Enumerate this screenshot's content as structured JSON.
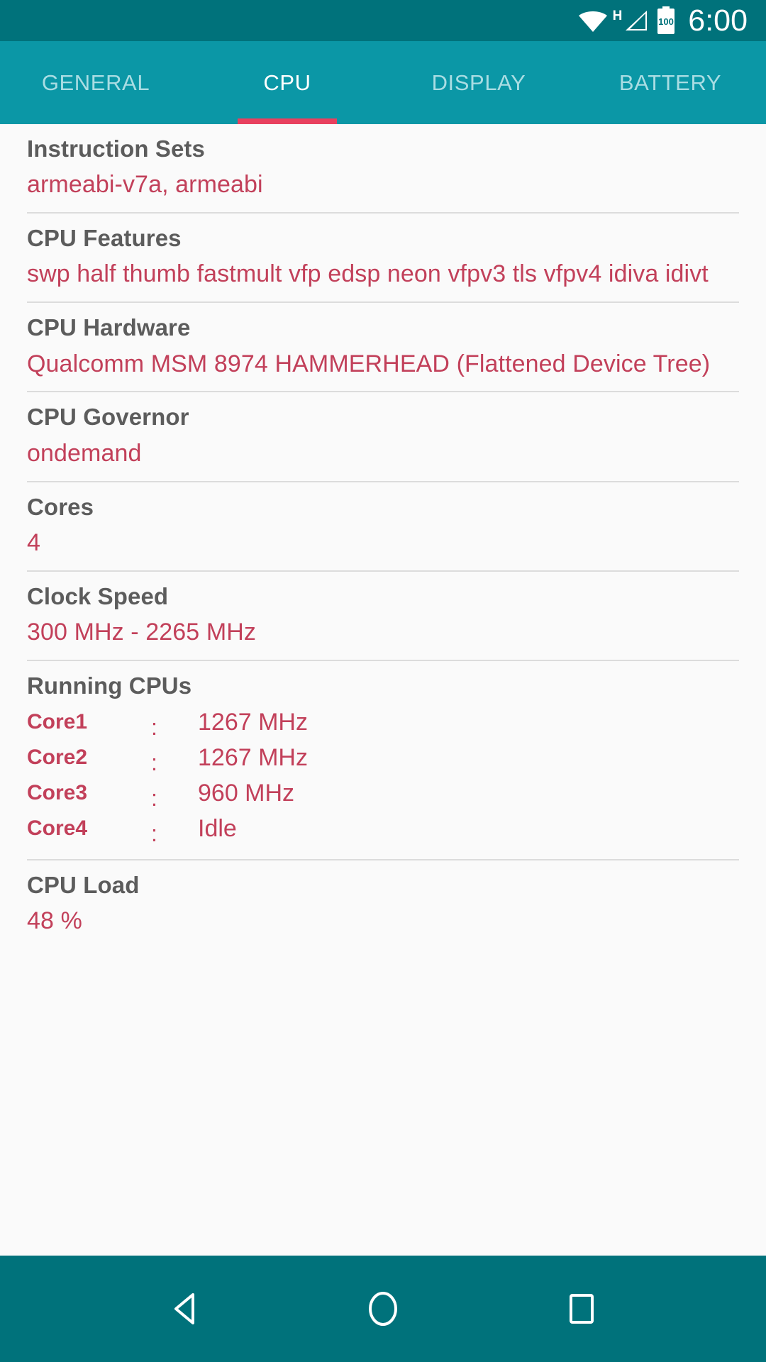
{
  "statusbar": {
    "wifi_icon": "wifi-icon",
    "network_type": "H",
    "signal_icon": "signal-bars-icon",
    "battery_level": "100",
    "battery_icon": "battery-icon",
    "time": "6:00"
  },
  "tabs": [
    {
      "label": "GENERAL",
      "active": false
    },
    {
      "label": "CPU",
      "active": true
    },
    {
      "label": "DISPLAY",
      "active": false
    },
    {
      "label": "BATTERY",
      "active": false
    }
  ],
  "rows": [
    {
      "label": "Instruction Sets",
      "value": "armeabi-v7a, armeabi"
    },
    {
      "label": "CPU Features",
      "value": "swp half thumb fastmult vfp edsp neon vfpv3 tls vfpv4 idiva idivt"
    },
    {
      "label": "CPU Hardware",
      "value": "Qualcomm MSM 8974 HAMMERHEAD (Flattened Device Tree)"
    },
    {
      "label": "CPU Governor",
      "value": "ondemand"
    },
    {
      "label": "Cores",
      "value": "4"
    },
    {
      "label": "Clock Speed",
      "value": "300 MHz - 2265 MHz"
    }
  ],
  "running_cpus": {
    "label": "Running CPUs",
    "separator": ":",
    "cores": [
      {
        "name": "Core1",
        "freq": "1267 MHz"
      },
      {
        "name": "Core2",
        "freq": "1267 MHz"
      },
      {
        "name": "Core3",
        "freq": "960 MHz"
      },
      {
        "name": "Core4",
        "freq": "Idle"
      }
    ]
  },
  "cpu_load": {
    "label": "CPU Load",
    "value": "48 %"
  },
  "navbar": {
    "back": "back-icon",
    "home": "home-icon",
    "recents": "recents-icon"
  },
  "colors": {
    "status_bar": "#00727b",
    "tab_bar": "#0b97a6",
    "accent_indicator": "#e8405e",
    "value_text": "#c2405a",
    "label_text": "#5c5c5c",
    "background": "#fafafa"
  }
}
